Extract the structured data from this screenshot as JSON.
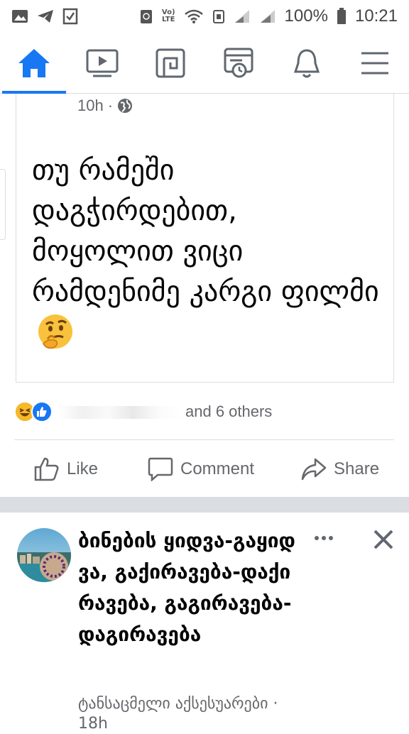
{
  "status_bar": {
    "battery": "100%",
    "time": "10:21",
    "volte_label": "Vo)) LTE",
    "icons": [
      "gallery-icon",
      "telegram-icon",
      "checklist-icon",
      "recycle-icon",
      "volte-icon",
      "wifi-icon",
      "data-icon",
      "signal-icon",
      "signal-icon",
      "battery-icon"
    ]
  },
  "nav": {
    "items": [
      {
        "name": "home",
        "icon": "home-icon",
        "active": true
      },
      {
        "name": "watch",
        "icon": "video-icon",
        "active": false
      },
      {
        "name": "marketplace",
        "icon": "shop-icon",
        "active": false
      },
      {
        "name": "memories",
        "icon": "memories-icon",
        "active": false
      },
      {
        "name": "notifications",
        "icon": "bell-icon",
        "active": false
      },
      {
        "name": "menu",
        "icon": "hamburger-menu-icon",
        "active": false
      }
    ],
    "accent_color": "#1877f2"
  },
  "post1": {
    "time": "10h",
    "separator": "·",
    "privacy_icon": "globe-icon",
    "text": "თუ რამეში დაგჭირდებით, მოყოლით ვიცი რამდენიმე კარგი ფილმი",
    "emoji": "thinking-face-emoji",
    "reactions": {
      "icons": [
        "haha-emoji-icon",
        "like-reaction-icon"
      ],
      "names_suffix": "and 6 others"
    },
    "actions": {
      "like": "Like",
      "comment": "Comment",
      "share": "Share"
    }
  },
  "post2": {
    "group_name": "ბინების ყიდვა-გაყიდვა, გაქირავება-დაქირავება, გაგირავება-დაგირავება",
    "sub_meta": "ტანსაცმელი აქსესუარები",
    "time": "18h",
    "separator": "·"
  }
}
